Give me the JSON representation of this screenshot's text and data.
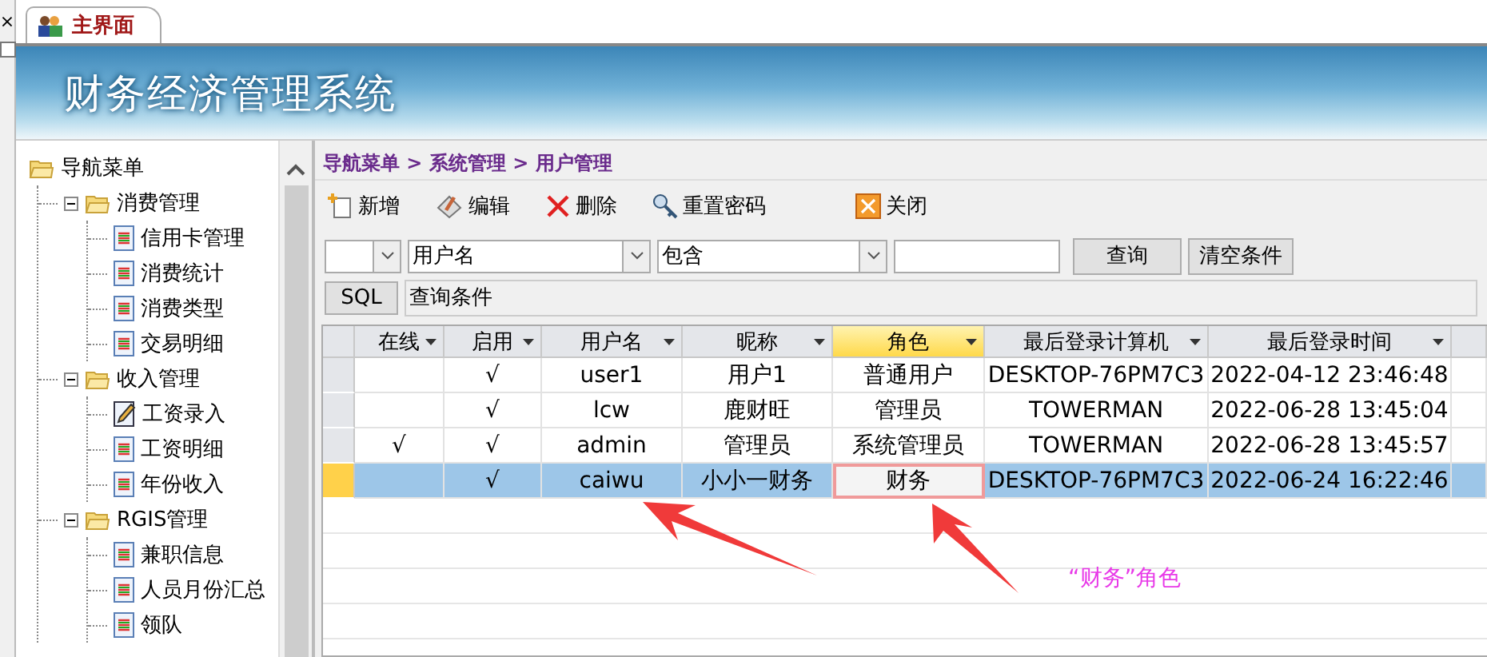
{
  "side_strip": {
    "close": "×"
  },
  "tab": {
    "label": "主界面",
    "selected": true
  },
  "banner": {
    "title": "财务经济管理系统"
  },
  "nav_tree": {
    "label": "导航菜单",
    "kind": "folder",
    "children": [
      {
        "label": "消费管理",
        "kind": "folder",
        "expanded": true,
        "children": [
          {
            "label": "信用卡管理",
            "kind": "page"
          },
          {
            "label": "消费统计",
            "kind": "page"
          },
          {
            "label": "消费类型",
            "kind": "page"
          },
          {
            "label": "交易明细",
            "kind": "page"
          }
        ]
      },
      {
        "label": "收入管理",
        "kind": "folder",
        "expanded": true,
        "children": [
          {
            "label": "工资录入",
            "kind": "edit"
          },
          {
            "label": "工资明细",
            "kind": "page"
          },
          {
            "label": "年份收入",
            "kind": "page"
          }
        ]
      },
      {
        "label": "RGIS管理",
        "kind": "folder",
        "expanded": true,
        "children": [
          {
            "label": "兼职信息",
            "kind": "page"
          },
          {
            "label": "人员月份汇总",
            "kind": "page"
          },
          {
            "label": "领队",
            "kind": "page"
          }
        ]
      }
    ]
  },
  "breadcrumb": "导航菜单 > 系统管理 > 用户管理",
  "toolbar": [
    {
      "label": "新增",
      "kind": "new"
    },
    {
      "label": "编辑",
      "kind": "edit"
    },
    {
      "label": "删除",
      "kind": "delete"
    },
    {
      "label": "重置密码",
      "kind": "key"
    },
    {
      "label": "关闭",
      "kind": "close"
    }
  ],
  "filter": {
    "field": "用户名",
    "operator": "包含",
    "buttons": [
      "查询",
      "清空条件"
    ]
  },
  "sql": {
    "button": "SQL",
    "label": "查询条件"
  },
  "table": {
    "columns": [
      {
        "label": "在线",
        "highlighted": false
      },
      {
        "label": "启用",
        "highlighted": false
      },
      {
        "label": "用户名",
        "highlighted": false
      },
      {
        "label": "昵称",
        "highlighted": false
      },
      {
        "label": "角色",
        "highlighted": true
      },
      {
        "label": "最后登录计算机",
        "highlighted": false
      },
      {
        "label": "最后登录时间",
        "highlighted": false
      }
    ],
    "rows": [
      {
        "selected": false,
        "role_focused": false,
        "cells": {
          "enabled": "√",
          "username": "user1",
          "nickname": "用户1",
          "role": "普通用户",
          "computer": "DESKTOP-76PM7C3",
          "last_login": "2022-04-12 23:46:48"
        }
      },
      {
        "selected": false,
        "role_focused": false,
        "cells": {
          "enabled": "√",
          "username": "lcw",
          "nickname": "鹿财旺",
          "role": "管理员",
          "computer": "TOWERMAN",
          "last_login": "2022-06-28 13:45:04"
        }
      },
      {
        "selected": false,
        "role_focused": false,
        "cells": {
          "online": "√",
          "enabled": "√",
          "username": "admin",
          "nickname": "管理员",
          "role": "系统管理员",
          "computer": "TOWERMAN",
          "last_login": "2022-06-28 13:45:57"
        }
      },
      {
        "selected": true,
        "role_focused": true,
        "cells": {
          "enabled": "√",
          "username": "caiwu",
          "nickname": "小小一财务",
          "role": "财务",
          "computer": "DESKTOP-76PM7C3",
          "last_login": "2022-06-24 16:22:46"
        }
      }
    ]
  },
  "annotation": {
    "text": "“财务”角色"
  }
}
